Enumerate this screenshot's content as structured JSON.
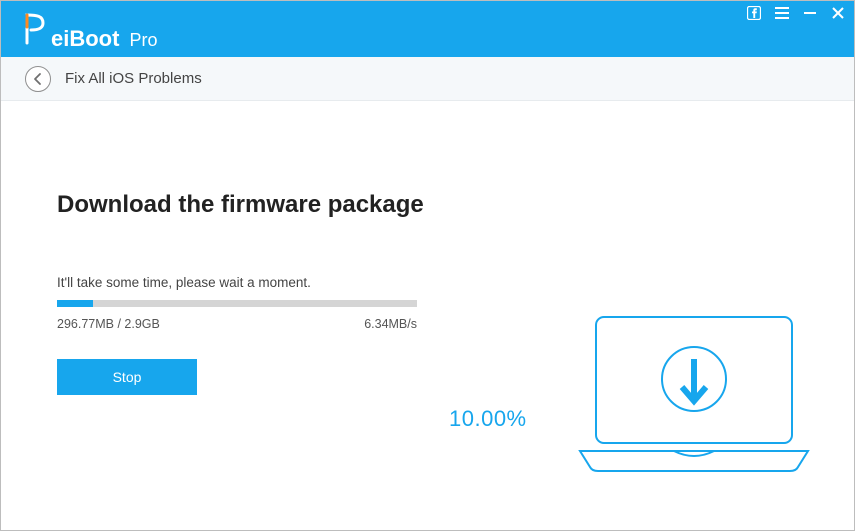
{
  "app": {
    "brand_first": "R",
    "brand_rest": "eiBoot",
    "brand_suffix": "Pro"
  },
  "breadcrumb": {
    "title": "Fix All iOS Problems"
  },
  "main": {
    "heading": "Download the firmware package",
    "subtext": "It'll take some time, please wait a moment.",
    "downloaded_of_total": "296.77MB / 2.9GB",
    "speed": "6.34MB/s",
    "percent_label": "10.00%",
    "progress_percent": 10,
    "stop_label": "Stop"
  },
  "colors": {
    "accent": "#17a6ed",
    "orange": "#ff8a1f"
  }
}
